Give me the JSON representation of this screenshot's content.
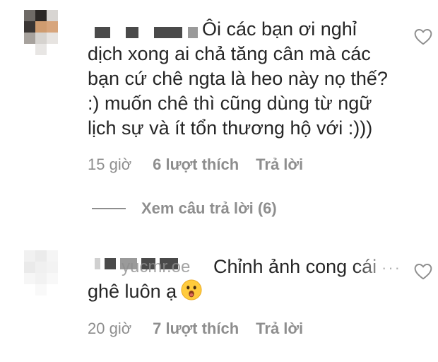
{
  "comments": [
    {
      "text_lines": [
        "Ôi các bạn ơi nghỉ",
        "dịch xong ai chả tăng cân mà các",
        "bạn cứ chê ngta là heo này nọ thế?",
        ":) muốn chê thì cũng dùng từ ngữ",
        "lịch sự và ít tổn thương hộ với :)))"
      ],
      "time": "15 giờ",
      "likes": "6 lượt thích",
      "reply": "Trả lời",
      "view_replies": "Xem câu trả lời (6)"
    },
    {
      "text_lines": [
        "Chỉnh ảnh cong cái",
        "ghê luôn ạ"
      ],
      "partial_username_text": "yucmr.oe",
      "emoji": "astonished-face-emoji",
      "time": "20 giờ",
      "likes": "7 lượt thích",
      "reply": "Trả lời"
    }
  ],
  "icons": {
    "heart": "heart-outline-icon"
  },
  "colors": {
    "text": "#262626",
    "muted": "#8e8e8e",
    "censor": "#4a4a4a"
  }
}
